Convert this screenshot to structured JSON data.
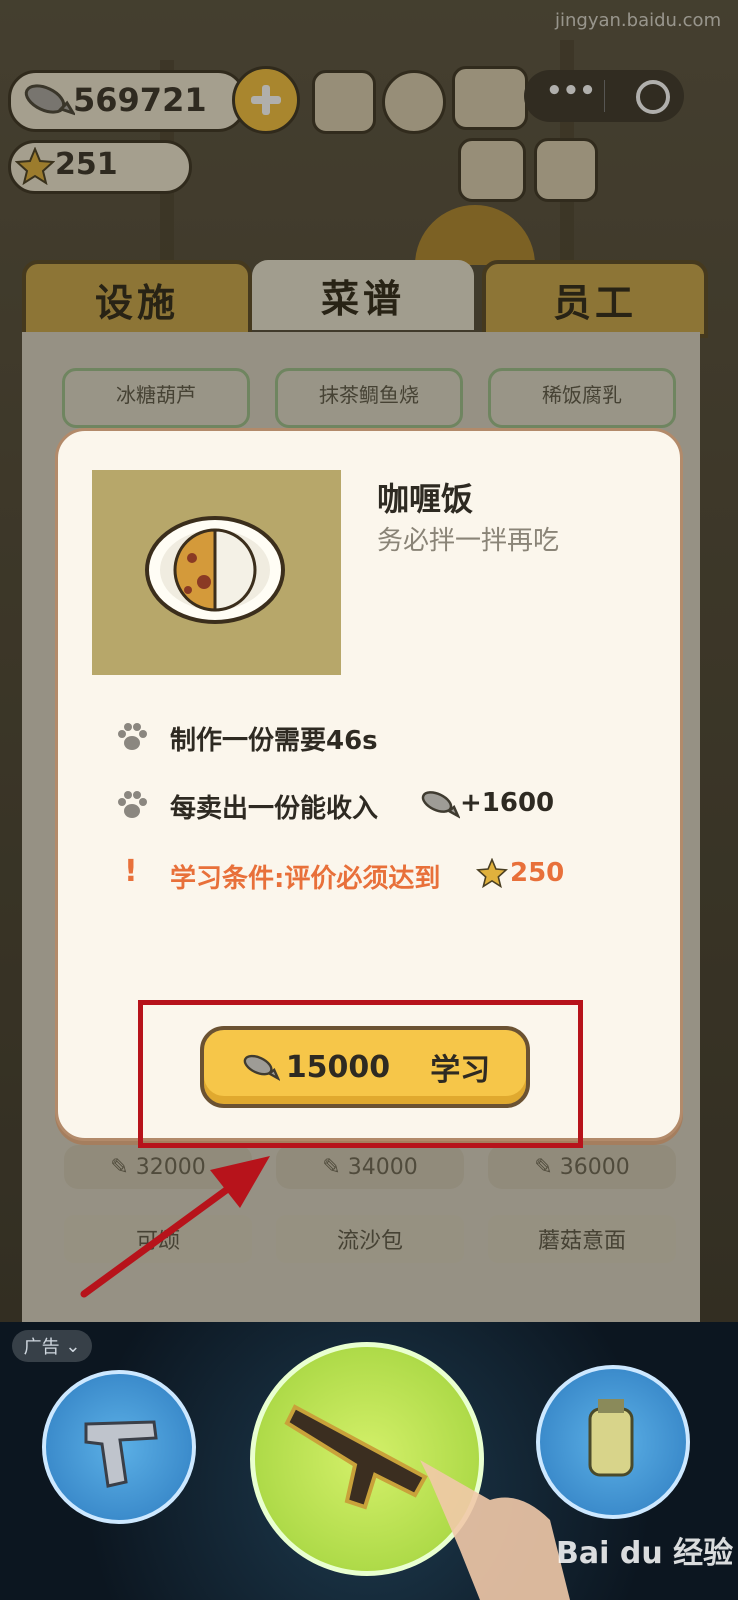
{
  "top_bar": {
    "fish_currency": "569721",
    "star_rating": "251"
  },
  "tabs": [
    {
      "label": "设施",
      "active": false
    },
    {
      "label": "菜谱",
      "active": true
    },
    {
      "label": "员工",
      "active": false
    }
  ],
  "recipe_cards_top": [
    "冰糖葫芦",
    "抹茶鲷鱼烧",
    "稀饭腐乳"
  ],
  "recipe_prices": [
    "32000",
    "34000",
    "36000"
  ],
  "recipe_names_bottom": [
    "可颂",
    "流沙包",
    "蘑菇意面"
  ],
  "modal": {
    "dish_name": "咖喱饭",
    "dish_desc": "务必拌一拌再吃",
    "make_time": "制作一份需要46s",
    "income_prefix": "每卖出一份能收入",
    "income_value": "+1600",
    "condition_prefix": "学习条件:评价必须达到",
    "condition_value": "250",
    "learn_price": "15000",
    "learn_label": "学习"
  },
  "ad": {
    "tag": "广告"
  },
  "watermark": {
    "brand": "Bai du 经验",
    "url": "jingyan.baidu.com"
  },
  "colors": {
    "accent_yellow": "#f6c649",
    "condition_orange": "#e8703a",
    "highlight_red": "#b7131b",
    "ad_green": "#b5e04a"
  }
}
